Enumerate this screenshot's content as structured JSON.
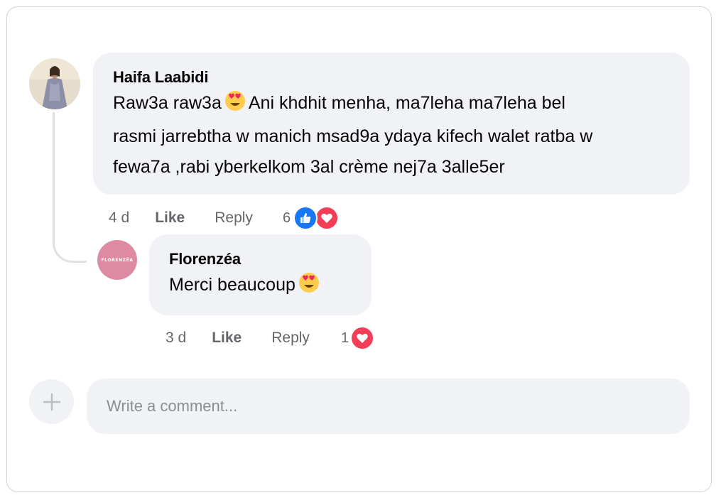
{
  "comments": [
    {
      "author": "Haifa Laabidi",
      "text_line1_a": "Raw3a raw3a",
      "text_line1_b": "Ani khdhit menha, ma7leha ma7leha bel",
      "text_line2": "rasmi jarrebtha w manich msad9a ydaya kifech walet ratba w",
      "text_line3": "fewa7a ,rabi yberkelkom 3al crème nej7a 3alle5er",
      "time": "4 d",
      "like_label": "Like",
      "reply_label": "Reply",
      "reaction_count": "6",
      "reactions": [
        "like-icon",
        "love-icon"
      ]
    },
    {
      "author": "Florenzéa",
      "avatar_text": "FLORENZÉA",
      "text": "Merci beaucoup",
      "time": "3 d",
      "like_label": "Like",
      "reply_label": "Reply",
      "reaction_count": "1",
      "reactions": [
        "love-icon"
      ]
    }
  ],
  "composer": {
    "placeholder": "Write a comment..."
  },
  "colors": {
    "bubble": "#f0f2f5",
    "like_blue": "#1877f2",
    "love_red": "#f33e58",
    "brand_pink": "#de8aa3",
    "meta_gray": "#65676b"
  }
}
